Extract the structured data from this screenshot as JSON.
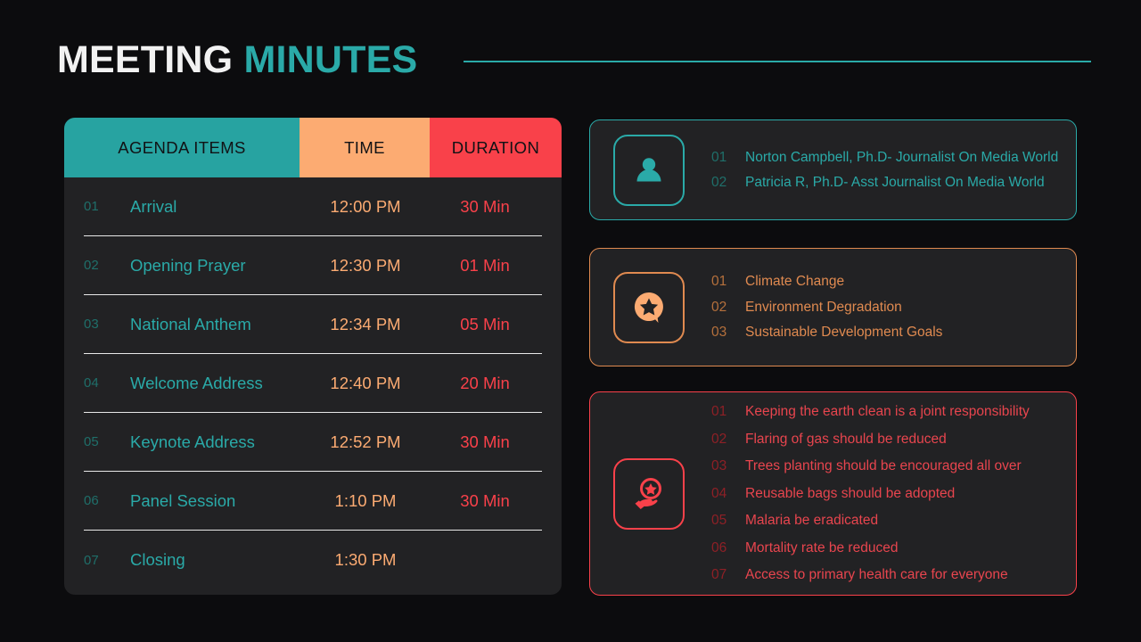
{
  "title": {
    "main": "MEETING",
    "accent": "MINUTES"
  },
  "colors": {
    "teal": "#2aaaa8",
    "orange": "#fcab72",
    "red": "#f9414a",
    "background": "#0c0c0e",
    "card": "#222224"
  },
  "agenda_table": {
    "headers": {
      "items": "AGENDA ITEMS",
      "time": "TIME",
      "duration": "DURATION"
    },
    "rows": [
      {
        "idx": "01",
        "label": "Arrival",
        "time": "12:00 PM",
        "duration": "30 Min"
      },
      {
        "idx": "02",
        "label": "Opening Prayer",
        "time": "12:30 PM",
        "duration": "01 Min"
      },
      {
        "idx": "03",
        "label": "National Anthem",
        "time": "12:34 PM",
        "duration": "05 Min"
      },
      {
        "idx": "04",
        "label": "Welcome Address",
        "time": "12:40 PM",
        "duration": "20 Min"
      },
      {
        "idx": "05",
        "label": "Keynote Address",
        "time": "12:52 PM",
        "duration": "30 Min"
      },
      {
        "idx": "06",
        "label": "Panel Session",
        "time": "1:10 PM",
        "duration": "30 Min"
      },
      {
        "idx": "07",
        "label": "Closing",
        "time": "1:30 PM",
        "duration": ""
      }
    ]
  },
  "panels": [
    {
      "icon": "person-icon",
      "accent": "#2aaaa8",
      "items": [
        {
          "idx": "01",
          "text": "Norton Campbell, Ph.D- Journalist On Media World"
        },
        {
          "idx": "02",
          "text": "Patricia R, Ph.D- Asst Journalist On Media World"
        }
      ]
    },
    {
      "icon": "speech-bubble-star-icon",
      "accent": "#e08a50",
      "items": [
        {
          "idx": "01",
          "text": "Climate Change"
        },
        {
          "idx": "02",
          "text": "Environment Degradation"
        },
        {
          "idx": "03",
          "text": "Sustainable Development Goals"
        }
      ]
    },
    {
      "icon": "hand-holding-star-icon",
      "accent": "#f9414a",
      "items": [
        {
          "idx": "01",
          "text": "Keeping the earth clean is a joint responsibility"
        },
        {
          "idx": "02",
          "text": "Flaring of gas should be reduced"
        },
        {
          "idx": "03",
          "text": "Trees planting should be encouraged all over"
        },
        {
          "idx": "04",
          "text": "Reusable bags should be adopted"
        },
        {
          "idx": "05",
          "text": "Malaria be eradicated"
        },
        {
          "idx": "06",
          "text": "Mortality rate be reduced"
        },
        {
          "idx": "07",
          "text": "Access to primary health care for everyone"
        }
      ]
    }
  ]
}
